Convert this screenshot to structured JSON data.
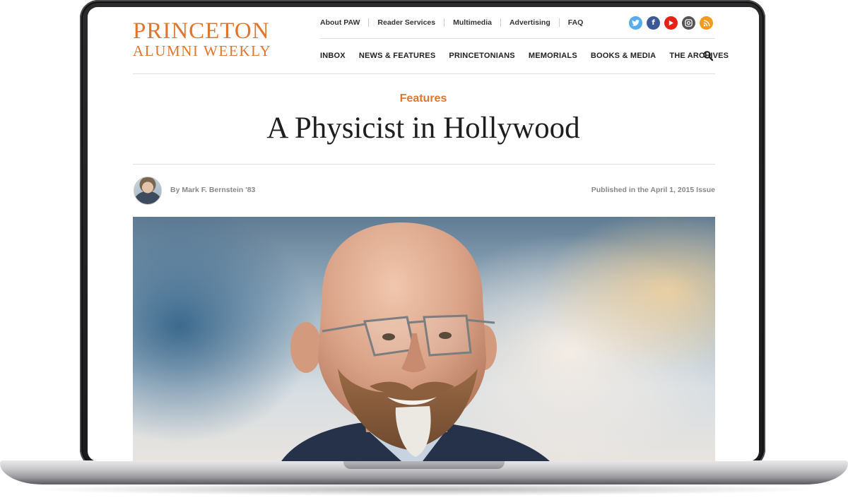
{
  "site": {
    "logo_line1": "PRINCETON",
    "logo_line2": "ALUMNI WEEKLY",
    "accent_color": "#e0752d"
  },
  "utility_nav": [
    "About PAW",
    "Reader Services",
    "Multimedia",
    "Advertising",
    "FAQ"
  ],
  "social_icons": [
    "twitter-icon",
    "facebook-icon",
    "youtube-icon",
    "instagram-icon",
    "rss-icon"
  ],
  "main_nav": [
    "INBOX",
    "NEWS & FEATURES",
    "PRINCETONIANS",
    "MEMORIALS",
    "BOOKS & MEDIA",
    "THE ARCHIVES"
  ],
  "article": {
    "section": "Features",
    "title": "A Physicist in Hollywood",
    "byline": "By Mark F. Bernstein '83",
    "published": "Published in the April 1, 2015 Issue"
  }
}
